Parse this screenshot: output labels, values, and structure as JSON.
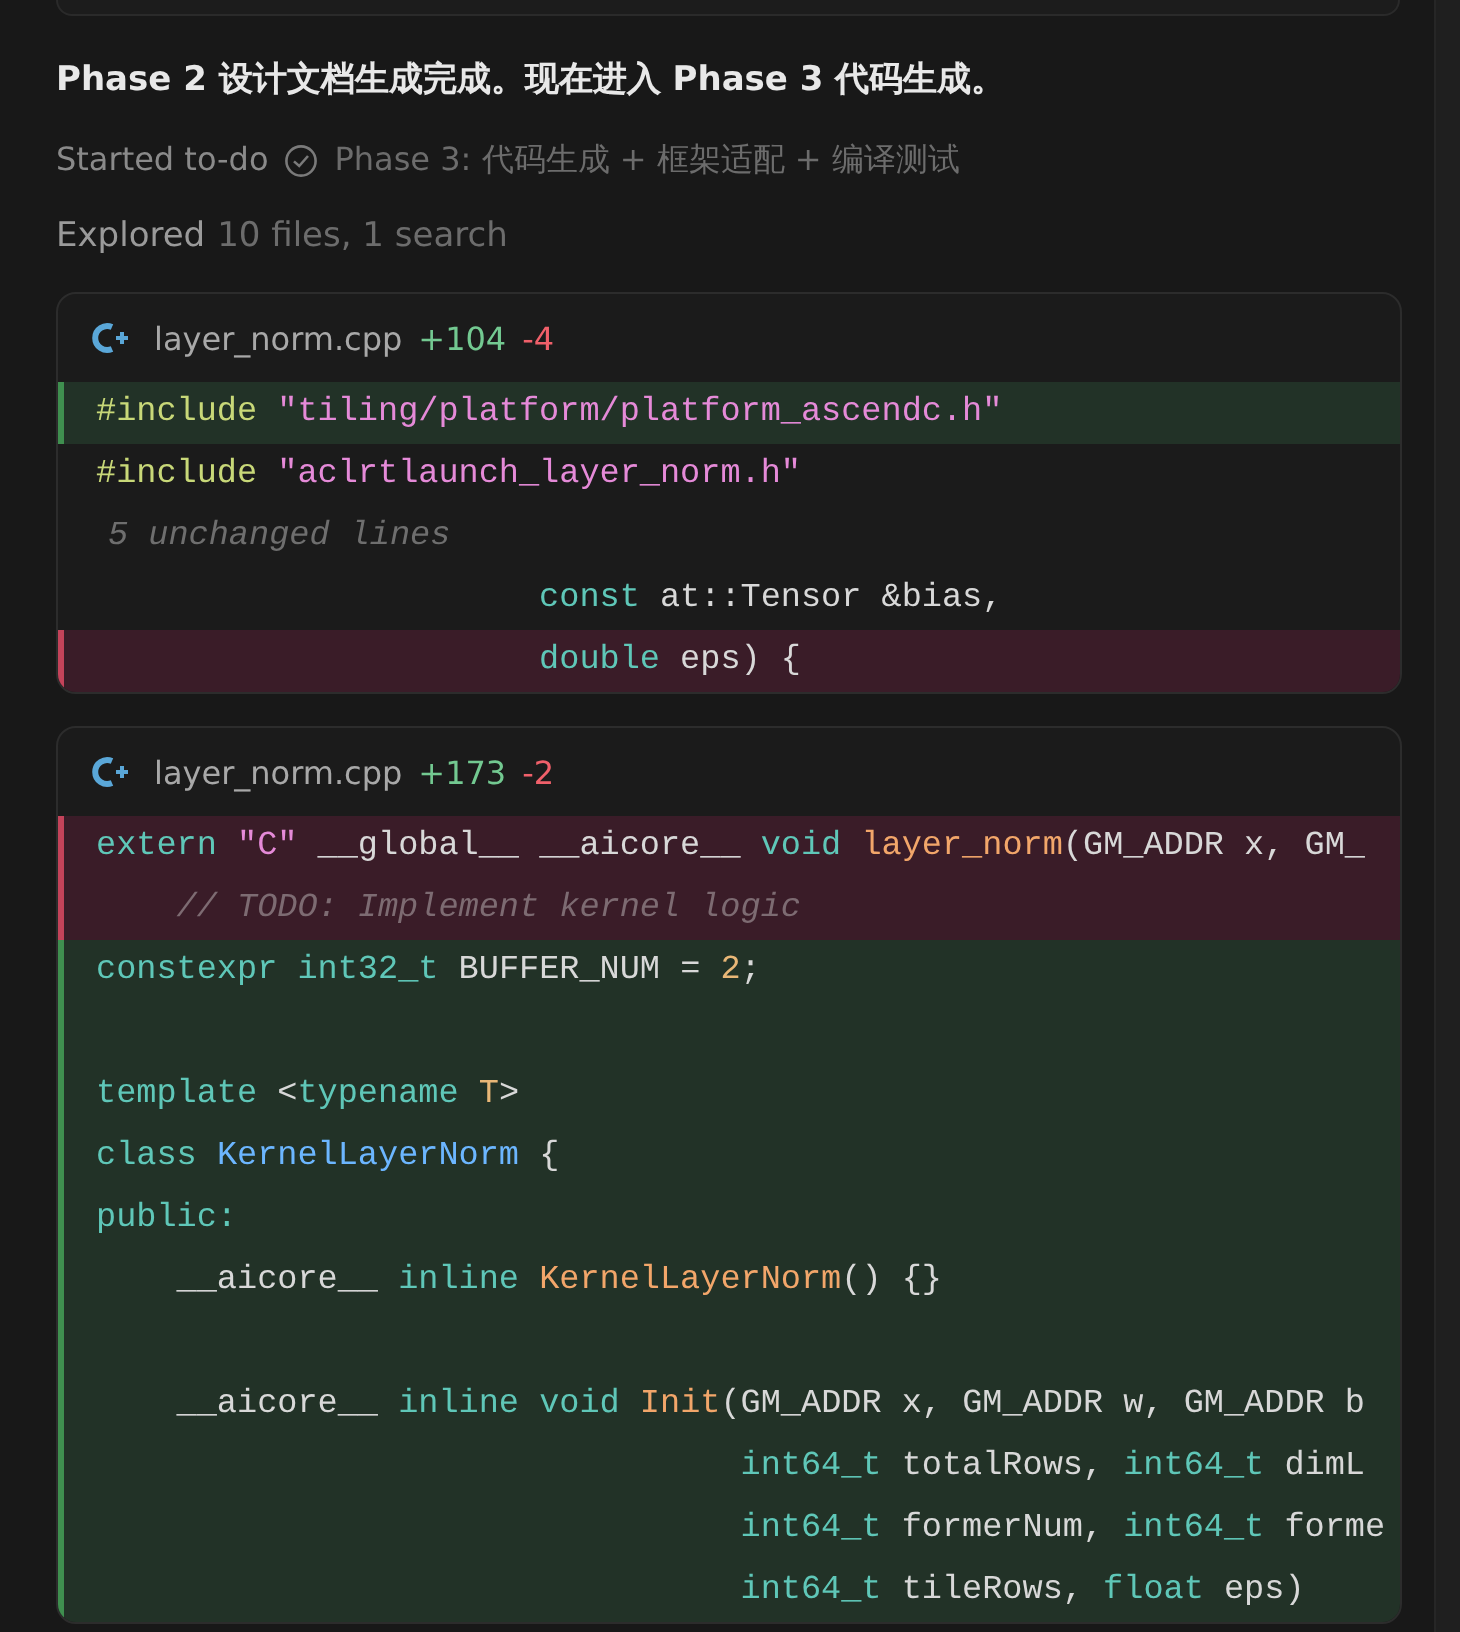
{
  "message": "Phase 2 设计文档生成完成。现在进入 Phase 3 代码生成。",
  "todo": {
    "label": "Started to-do",
    "done": true,
    "text": "Phase 3: 代码生成 + 框架适配 + 编译测试"
  },
  "explored": {
    "label": "Explored",
    "detail": "10 files, 1 search"
  },
  "diffs": [
    {
      "file": "layer_norm.cpp",
      "added": "+104",
      "removed": "-4",
      "lines": [
        {
          "kind": "added",
          "tokens": [
            {
              "t": "#include ",
              "kind": "directive"
            },
            {
              "t": "\"tiling/platform/platform_ascendc.h\"",
              "kind": "string"
            }
          ]
        },
        {
          "kind": "context",
          "tokens": [
            {
              "t": "#include ",
              "kind": "directive"
            },
            {
              "t": "\"aclrtlaunch_layer_norm.h\"",
              "kind": "string"
            }
          ]
        },
        {
          "kind": "fold",
          "text": "5 unchanged lines"
        },
        {
          "kind": "context",
          "tokens": [
            {
              "t": "                      const ",
              "kind": "keyword"
            },
            {
              "t": "at::Tensor &bias,",
              "kind": "plain"
            }
          ]
        },
        {
          "kind": "removed",
          "tokens": [
            {
              "t": "                      double ",
              "kind": "keyword"
            },
            {
              "t": "eps) {",
              "kind": "plain"
            }
          ]
        }
      ]
    },
    {
      "file": "layer_norm.cpp",
      "added": "+173",
      "removed": "-2",
      "lines": [
        {
          "kind": "removed",
          "tokens": [
            {
              "t": "extern ",
              "kind": "keyword"
            },
            {
              "t": "\"C\"",
              "kind": "string"
            },
            {
              "t": " __global__ __aicore__ ",
              "kind": "plain"
            },
            {
              "t": "void ",
              "kind": "keyword"
            },
            {
              "t": "layer_norm",
              "kind": "func"
            },
            {
              "t": "(GM_ADDR x, GM_",
              "kind": "plain"
            }
          ]
        },
        {
          "kind": "removed",
          "tokens": [
            {
              "t": "    // TODO: Implement kernel logic",
              "kind": "comment"
            }
          ]
        },
        {
          "kind": "added",
          "tokens": [
            {
              "t": "constexpr ",
              "kind": "keyword"
            },
            {
              "t": "int32_t ",
              "kind": "keyword"
            },
            {
              "t": "BUFFER_NUM = ",
              "kind": "plain"
            },
            {
              "t": "2",
              "kind": "number"
            },
            {
              "t": ";",
              "kind": "plain"
            }
          ]
        },
        {
          "kind": "added"
        },
        {
          "kind": "added",
          "tokens": [
            {
              "t": "template ",
              "kind": "keyword"
            },
            {
              "t": "<",
              "kind": "plain"
            },
            {
              "t": "typename ",
              "kind": "keyword"
            },
            {
              "t": "T",
              "kind": "number"
            },
            {
              "t": ">",
              "kind": "plain"
            }
          ]
        },
        {
          "kind": "added",
          "tokens": [
            {
              "t": "class ",
              "kind": "keyword"
            },
            {
              "t": "KernelLayerNorm",
              "kind": "type"
            },
            {
              "t": " {",
              "kind": "plain"
            }
          ]
        },
        {
          "kind": "added",
          "tokens": [
            {
              "t": "public:",
              "kind": "keyword"
            }
          ]
        },
        {
          "kind": "added",
          "tokens": [
            {
              "t": "    __aicore__ ",
              "kind": "plain"
            },
            {
              "t": "inline ",
              "kind": "keyword"
            },
            {
              "t": "KernelLayerNorm",
              "kind": "func"
            },
            {
              "t": "() {}",
              "kind": "plain"
            }
          ]
        },
        {
          "kind": "added"
        },
        {
          "kind": "added",
          "tokens": [
            {
              "t": "    __aicore__ ",
              "kind": "plain"
            },
            {
              "t": "inline ",
              "kind": "keyword"
            },
            {
              "t": "void ",
              "kind": "keyword"
            },
            {
              "t": "Init",
              "kind": "func"
            },
            {
              "t": "(GM_ADDR x, GM_ADDR w, GM_ADDR b",
              "kind": "plain"
            }
          ]
        },
        {
          "kind": "added",
          "tokens": [
            {
              "t": "                                int64_t ",
              "kind": "keyword"
            },
            {
              "t": "totalRows, ",
              "kind": "plain"
            },
            {
              "t": "int64_t ",
              "kind": "keyword"
            },
            {
              "t": "dimL",
              "kind": "plain"
            }
          ]
        },
        {
          "kind": "added",
          "tokens": [
            {
              "t": "                                int64_t ",
              "kind": "keyword"
            },
            {
              "t": "formerNum, ",
              "kind": "plain"
            },
            {
              "t": "int64_t ",
              "kind": "keyword"
            },
            {
              "t": "forme",
              "kind": "plain"
            }
          ]
        },
        {
          "kind": "added",
          "tokens": [
            {
              "t": "                                int64_t ",
              "kind": "keyword"
            },
            {
              "t": "tileRows, ",
              "kind": "plain"
            },
            {
              "t": "float ",
              "kind": "keyword"
            },
            {
              "t": "eps)",
              "kind": "plain"
            }
          ]
        }
      ]
    }
  ]
}
